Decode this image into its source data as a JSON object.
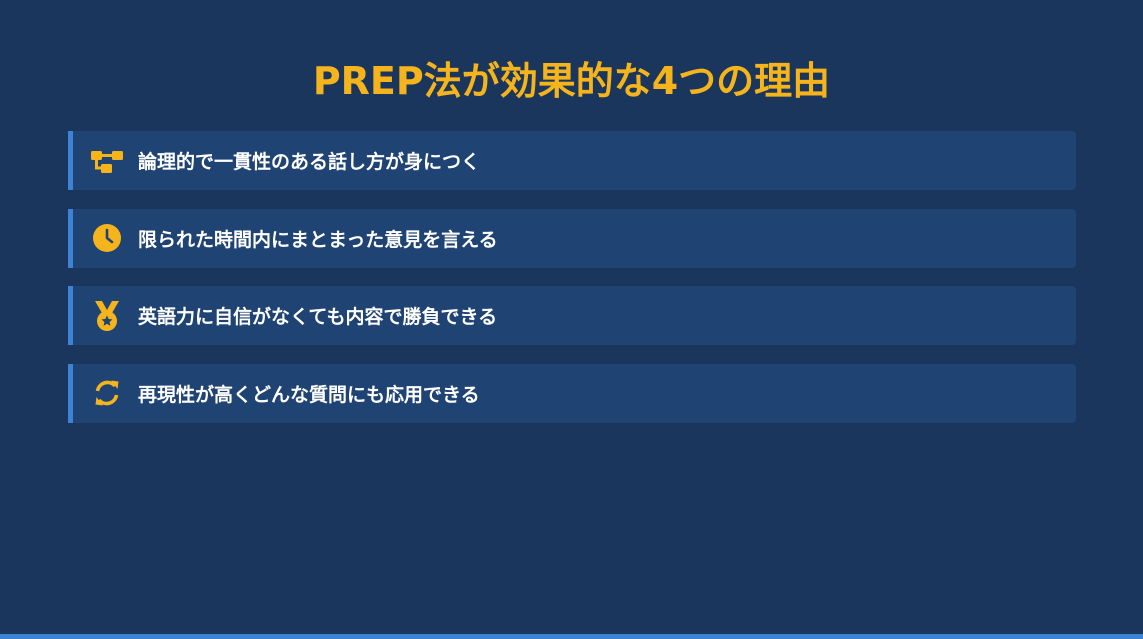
{
  "title": "PREP法が効果的な4つの理由",
  "colors": {
    "background": "#1b365d",
    "card": "#1f4373",
    "accent": "#3c83d6",
    "title": "#f5b41c",
    "icon": "#f5b41c",
    "text": "#ffffff"
  },
  "reasons": [
    {
      "icon": "sitemap-icon",
      "text": "論理的で一貫性のある話し方が身につく"
    },
    {
      "icon": "clock-icon",
      "text": "限られた時間内にまとまった意見を言える"
    },
    {
      "icon": "medal-icon",
      "text": "英語力に自信がなくても内容で勝負できる"
    },
    {
      "icon": "sync-icon",
      "text": "再現性が高くどんな質問にも応用できる"
    }
  ]
}
